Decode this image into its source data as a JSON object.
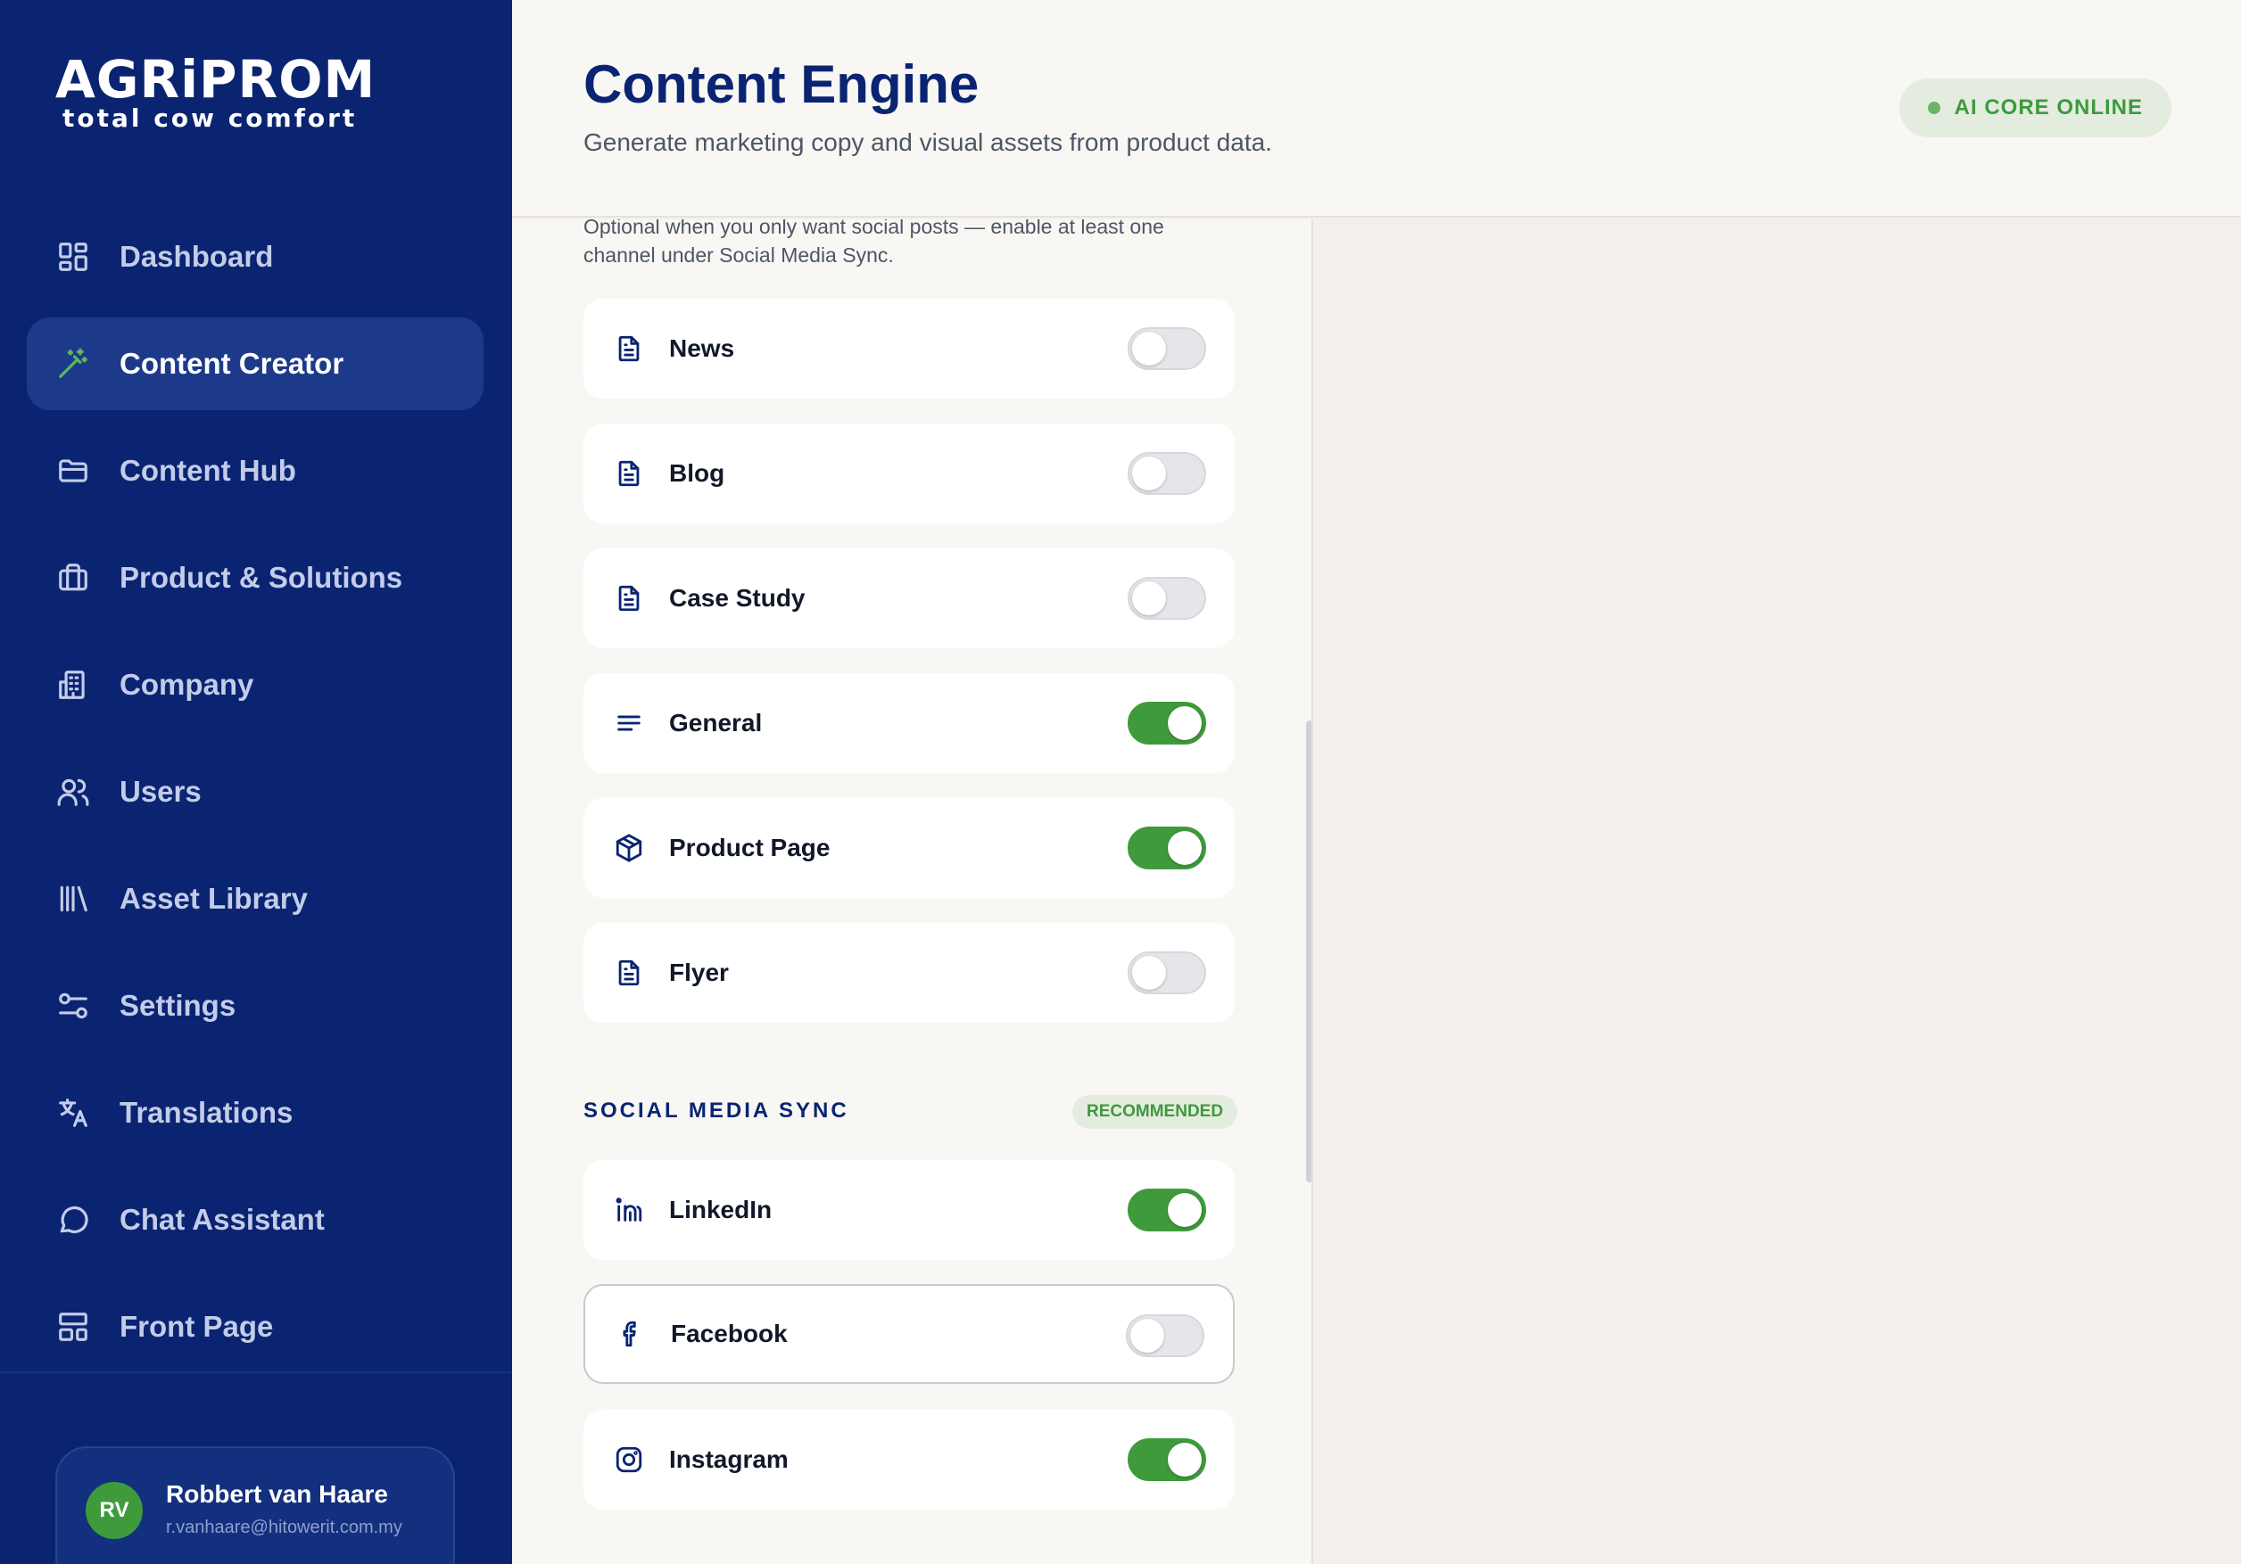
{
  "brand": {
    "name": "AGRiPROM",
    "tagline": "total cow comfort"
  },
  "sidebar": {
    "items": [
      {
        "label": "Dashboard",
        "icon": "dashboard-icon",
        "active": false
      },
      {
        "label": "Content Creator",
        "icon": "magic-wand-icon",
        "active": true
      },
      {
        "label": "Content Hub",
        "icon": "folder-icon",
        "active": false
      },
      {
        "label": "Product & Solutions",
        "icon": "briefcase-icon",
        "active": false
      },
      {
        "label": "Company",
        "icon": "building-icon",
        "active": false
      },
      {
        "label": "Users",
        "icon": "users-icon",
        "active": false
      },
      {
        "label": "Asset Library",
        "icon": "library-icon",
        "active": false
      },
      {
        "label": "Settings",
        "icon": "sliders-icon",
        "active": false
      },
      {
        "label": "Translations",
        "icon": "translate-icon",
        "active": false
      },
      {
        "label": "Chat Assistant",
        "icon": "chat-icon",
        "active": false
      },
      {
        "label": "Front Page",
        "icon": "layout-icon",
        "active": false
      }
    ],
    "user": {
      "initials": "RV",
      "name": "Robbert van Haare",
      "email": "r.vanhaare@hitowerit.com.my"
    }
  },
  "header": {
    "title": "Content Engine",
    "subtitle": "Generate marketing copy and visual assets from product data.",
    "status": "AI CORE ONLINE"
  },
  "panel": {
    "hint": "Optional when you only want social posts — enable at least one channel under Social Media Sync.",
    "content_types": [
      {
        "label": "News",
        "icon": "document-icon",
        "enabled": false
      },
      {
        "label": "Blog",
        "icon": "document-icon",
        "enabled": false
      },
      {
        "label": "Case Study",
        "icon": "document-icon",
        "enabled": false
      },
      {
        "label": "General",
        "icon": "text-lines-icon",
        "enabled": true
      },
      {
        "label": "Product Page",
        "icon": "box-icon",
        "enabled": true
      },
      {
        "label": "Flyer",
        "icon": "document-icon",
        "enabled": false
      }
    ],
    "social": {
      "title": "SOCIAL MEDIA SYNC",
      "badge": "RECOMMENDED",
      "channels": [
        {
          "label": "LinkedIn",
          "icon": "linkedin-icon",
          "enabled": true
        },
        {
          "label": "Facebook",
          "icon": "facebook-icon",
          "enabled": false
        },
        {
          "label": "Instagram",
          "icon": "instagram-icon",
          "enabled": true
        }
      ]
    }
  },
  "colors": {
    "navy": "#0a2472",
    "green": "#3f9a3c",
    "background": "#f3f0eb"
  }
}
